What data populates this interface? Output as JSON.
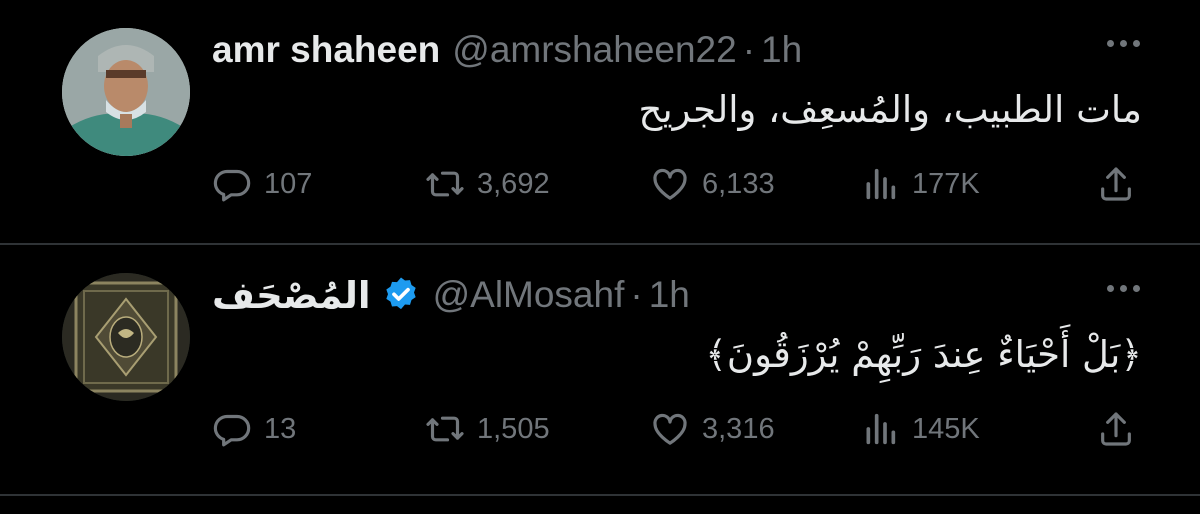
{
  "tweets": [
    {
      "author_name": "amr shaheen",
      "handle": "@amrshaheen22",
      "separator": "·",
      "time": "1h",
      "verified": false,
      "text": "مات الطبيب، والمُسعِف، والجريح",
      "replies": "107",
      "retweets": "3,692",
      "likes": "6,133",
      "views": "177K"
    },
    {
      "author_name": "المُصْحَف",
      "handle": "@AlMosahf",
      "separator": "·",
      "time": "1h",
      "verified": true,
      "text": "﴿بَلْ أَحْيَاءٌ عِندَ رَبِّهِمْ يُرْزَقُونَ﴾",
      "replies": "13",
      "retweets": "1,505",
      "likes": "3,316",
      "views": "145K"
    }
  ],
  "icons": {
    "reply": "reply-icon",
    "retweet": "retweet-icon",
    "like": "like-icon",
    "views": "views-icon",
    "share": "share-icon",
    "more": "more-icon",
    "verified": "verified-badge-icon"
  },
  "colors": {
    "background": "#000000",
    "text": "#e7e9ea",
    "muted": "#71767b",
    "divider": "#2f3336",
    "verified": "#1d9bf0"
  }
}
